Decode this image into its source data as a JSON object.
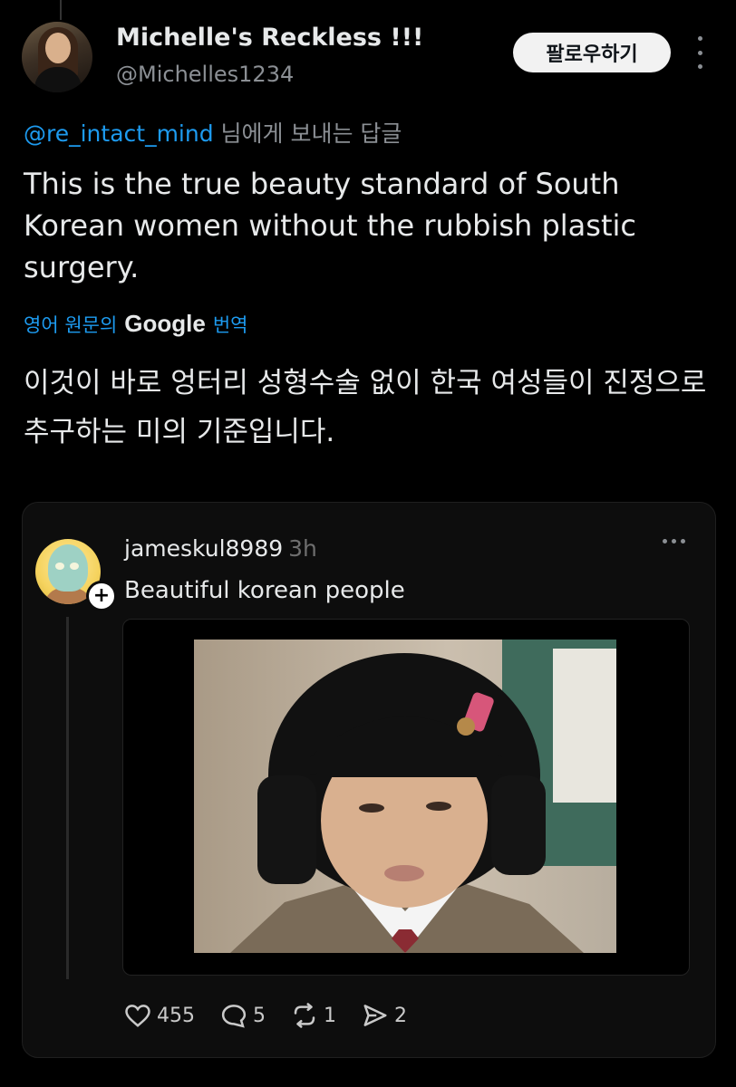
{
  "tweet": {
    "user_name": "Michelle's Reckless !!!",
    "handle": "@Michelles1234",
    "follow_label": "팔로우하기",
    "reply_to_mention": "@re_intact_mind",
    "reply_to_suffix": " 님에게 보내는 답글",
    "text": "This is the true beauty standard of South Korean women without the rubbish plastic surgery.",
    "translate_prefix": "영어 원문의",
    "translate_brand": "Google",
    "translate_suffix": "번역",
    "translated_text": "이것이 바로 엉터리 성형수술 없이 한국 여성들이 진정으로 추구하는 미의 기준입니다."
  },
  "quote": {
    "username": "jameskul8989",
    "time": "3h",
    "text": "Beautiful korean people",
    "likes": "455",
    "replies": "5",
    "reposts": "1",
    "shares": "2"
  },
  "icons": {
    "more": "more-vertical-icon",
    "like": "heart-icon",
    "reply": "comment-icon",
    "repost": "repost-icon",
    "share": "send-icon"
  },
  "colors": {
    "background": "#000000",
    "link": "#1d9bf0",
    "text": "#e7e9ea",
    "muted": "#8b8f94"
  }
}
